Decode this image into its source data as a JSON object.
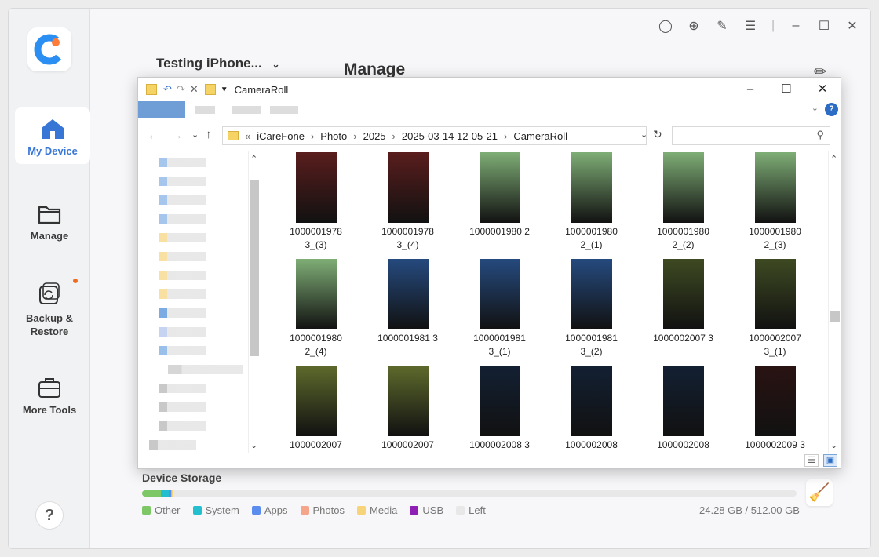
{
  "sidebar": {
    "items": [
      {
        "label": "My Device",
        "icon": "home-icon",
        "active": true
      },
      {
        "label": "Manage",
        "icon": "folder-icon"
      },
      {
        "label": "Backup & Restore",
        "icon": "backup-restore-icon",
        "badge": true
      },
      {
        "label": "More Tools",
        "icon": "toolbox-icon"
      }
    ],
    "help": "?"
  },
  "header": {
    "device": "Testing iPhone...",
    "title": "Manage"
  },
  "explorer": {
    "title": "CameraRoll",
    "path": [
      "iCareFone",
      "Photo",
      "2025",
      "2025-03-14 12-05-21",
      "CameraRoll"
    ],
    "files": [
      {
        "name": "1000001978 3_(3)",
        "color": "#5a1d1d"
      },
      {
        "name": "1000001978 3_(4)",
        "color": "#5a1d1d"
      },
      {
        "name": "1000001980 2",
        "color": "#7fae76"
      },
      {
        "name": "1000001980 2_(1)",
        "color": "#7fae76"
      },
      {
        "name": "1000001980 2_(2)",
        "color": "#7fae76"
      },
      {
        "name": "1000001980 2_(3)",
        "color": "#7fae76"
      },
      {
        "name": "1000001980 2_(4)",
        "color": "#7fae76"
      },
      {
        "name": "1000001981 3",
        "color": "#254a7e"
      },
      {
        "name": "1000001981 3_(1)",
        "color": "#254a7e"
      },
      {
        "name": "1000001981 3_(2)",
        "color": "#254a7e"
      },
      {
        "name": "1000002007 3",
        "color": "#3e4a22"
      },
      {
        "name": "1000002007 3_(1)",
        "color": "#3e4a22"
      },
      {
        "name": "1000002007",
        "color": "#5e6a2c"
      },
      {
        "name": "1000002007",
        "color": "#5e6a2c"
      },
      {
        "name": "1000002008 3",
        "color": "#132033"
      },
      {
        "name": "1000002008",
        "color": "#132033"
      },
      {
        "name": "1000002008",
        "color": "#132033"
      },
      {
        "name": "1000002009 3",
        "color": "#2a1313"
      }
    ]
  },
  "storage": {
    "title": "Device Storage",
    "used": "24.28 GB / 512.00 GB",
    "segments": [
      {
        "name": "Other",
        "color": "#7dc766",
        "fraction": 0.029
      },
      {
        "name": "System",
        "color": "#23bfcf",
        "fraction": 0.012
      },
      {
        "name": "Apps",
        "color": "#5b8def",
        "fraction": 0.003
      },
      {
        "name": "Photos",
        "color": "#f4a58a",
        "fraction": 0.002
      },
      {
        "name": "Media",
        "color": "#f7d37a",
        "fraction": 0.001
      },
      {
        "name": "USB",
        "color": "#8f1eb5",
        "fraction": 0.0
      },
      {
        "name": "Left",
        "color": "#e8e8e8",
        "fraction": 0.0
      }
    ]
  }
}
